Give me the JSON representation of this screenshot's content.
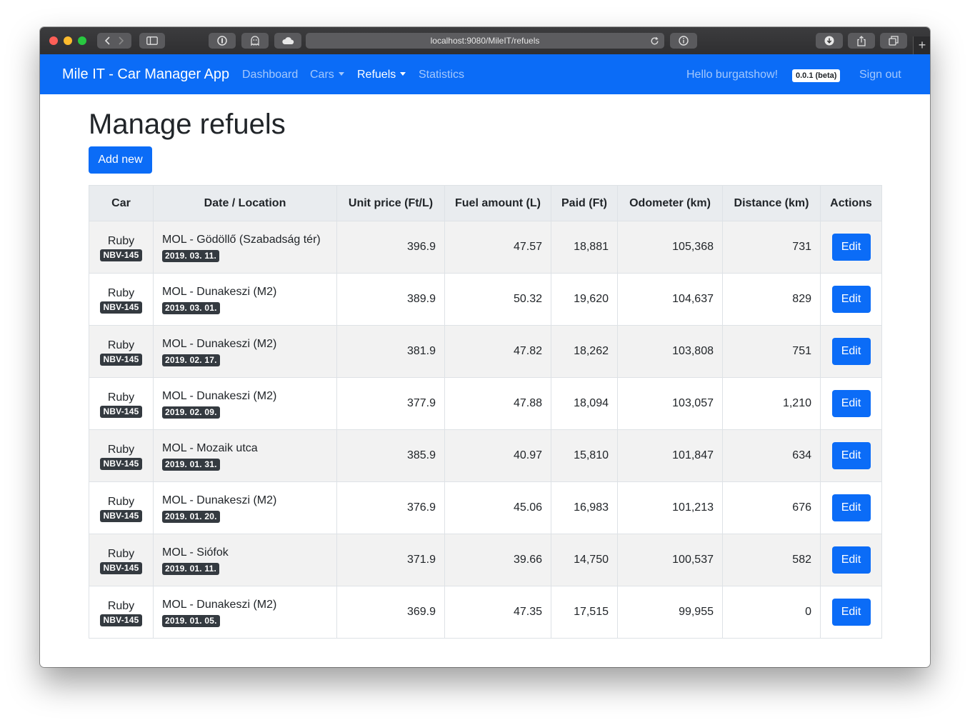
{
  "browser": {
    "url": "localhost:9080/MileIT/refuels"
  },
  "navbar": {
    "brand": "Mile IT - Car Manager App",
    "links": [
      {
        "label": "Dashboard"
      },
      {
        "label": "Cars"
      },
      {
        "label": "Refuels"
      },
      {
        "label": "Statistics"
      }
    ],
    "greeting": "Hello burgatshow!",
    "version": "0.0.1 (beta)",
    "signout": "Sign out"
  },
  "page": {
    "title": "Manage refuels",
    "add_button": "Add new"
  },
  "table": {
    "headers": [
      "Car",
      "Date / Location",
      "Unit price (Ft/L)",
      "Fuel amount (L)",
      "Paid (Ft)",
      "Odometer (km)",
      "Distance (km)",
      "Actions"
    ],
    "edit_label": "Edit",
    "rows": [
      {
        "car": "Ruby",
        "plate": "NBV-145",
        "location": "MOL - Gödöllő (Szabadság tér)",
        "date": "2019. 03. 11.",
        "unit_price": "396.9",
        "fuel": "47.57",
        "paid": "18,881",
        "odometer": "105,368",
        "distance": "731"
      },
      {
        "car": "Ruby",
        "plate": "NBV-145",
        "location": "MOL - Dunakeszi (M2)",
        "date": "2019. 03. 01.",
        "unit_price": "389.9",
        "fuel": "50.32",
        "paid": "19,620",
        "odometer": "104,637",
        "distance": "829"
      },
      {
        "car": "Ruby",
        "plate": "NBV-145",
        "location": "MOL - Dunakeszi (M2)",
        "date": "2019. 02. 17.",
        "unit_price": "381.9",
        "fuel": "47.82",
        "paid": "18,262",
        "odometer": "103,808",
        "distance": "751"
      },
      {
        "car": "Ruby",
        "plate": "NBV-145",
        "location": "MOL - Dunakeszi (M2)",
        "date": "2019. 02. 09.",
        "unit_price": "377.9",
        "fuel": "47.88",
        "paid": "18,094",
        "odometer": "103,057",
        "distance": "1,210"
      },
      {
        "car": "Ruby",
        "plate": "NBV-145",
        "location": "MOL - Mozaik utca",
        "date": "2019. 01. 31.",
        "unit_price": "385.9",
        "fuel": "40.97",
        "paid": "15,810",
        "odometer": "101,847",
        "distance": "634"
      },
      {
        "car": "Ruby",
        "plate": "NBV-145",
        "location": "MOL - Dunakeszi (M2)",
        "date": "2019. 01. 20.",
        "unit_price": "376.9",
        "fuel": "45.06",
        "paid": "16,983",
        "odometer": "101,213",
        "distance": "676"
      },
      {
        "car": "Ruby",
        "plate": "NBV-145",
        "location": "MOL - Siófok",
        "date": "2019. 01. 11.",
        "unit_price": "371.9",
        "fuel": "39.66",
        "paid": "14,750",
        "odometer": "100,537",
        "distance": "582"
      },
      {
        "car": "Ruby",
        "plate": "NBV-145",
        "location": "MOL - Dunakeszi (M2)",
        "date": "2019. 01. 05.",
        "unit_price": "369.9",
        "fuel": "47.35",
        "paid": "17,515",
        "odometer": "99,955",
        "distance": "0"
      }
    ]
  },
  "colors": {
    "primary": "#0b6cf7",
    "badge_dark": "#343a40",
    "table_header": "#e9ecef",
    "stripe": "#f2f2f2"
  }
}
